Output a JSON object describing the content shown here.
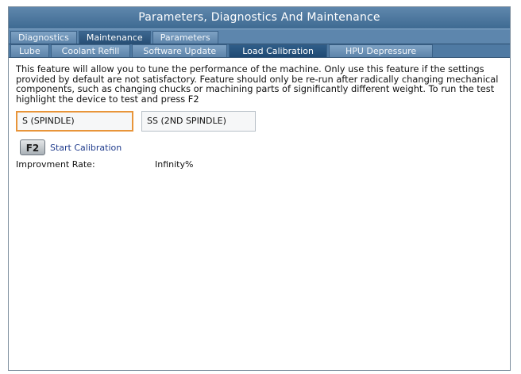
{
  "window": {
    "title": "Parameters, Diagnostics And Maintenance"
  },
  "tabs": {
    "main": [
      {
        "label": "Diagnostics",
        "active": false
      },
      {
        "label": "Maintenance",
        "active": true
      },
      {
        "label": "Parameters",
        "active": false
      }
    ],
    "sub": [
      {
        "label": "Lube",
        "active": false
      },
      {
        "label": "Coolant Refill",
        "active": false
      },
      {
        "label": "Software Update",
        "active": false
      },
      {
        "label": "Load Calibration",
        "active": true
      },
      {
        "label": "HPU Depressure",
        "active": false
      }
    ]
  },
  "content": {
    "description": "This feature will allow you to tune the performance of the machine. Only use this feature if the settings provided by default are not satisfactory. Feature should only be re-run after radically changing mechanical components, such as changing chucks or machining parts of significantly different weight. To run the test highlight the device to test and press F2",
    "devices": [
      {
        "label": "S (SPINDLE)",
        "selected": true
      },
      {
        "label": "SS (2ND SPINDLE)",
        "selected": false
      }
    ],
    "calibration": {
      "key": "F2",
      "label": "Start Calibration"
    },
    "improvement": {
      "label": "Improvment Rate:",
      "value": "Infinity%"
    }
  },
  "colors": {
    "title_bar": "#4f7aa3",
    "selection_border": "#e8953a",
    "link_text": "#1f3b8c"
  }
}
